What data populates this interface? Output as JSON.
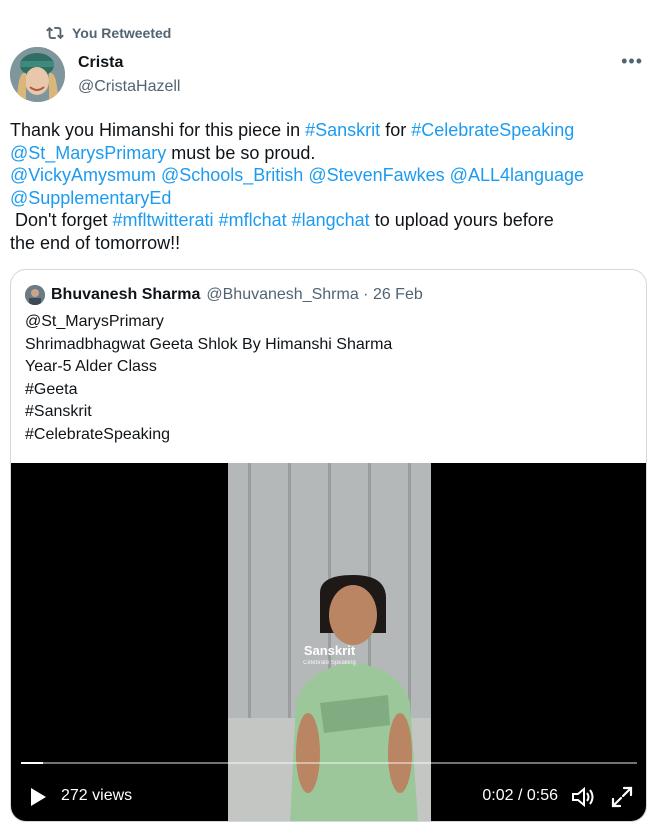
{
  "retweet": {
    "label": "You Retweeted",
    "icon": "retweet-icon"
  },
  "author": {
    "name": "Crista",
    "handle": "@CristaHazell"
  },
  "tweet": {
    "line1_pre": "Thank you Himanshi for this piece in ",
    "tag_sanskrit": "#Sanskrit",
    "line1_mid": " for ",
    "tag_celebrate": "#CelebrateSpeaking",
    "mention_st_marys": "@St_MarysPrimary",
    "line2_post": " must be so proud.",
    "mention_vicky": "@VickyAmysmum",
    "mention_schools": "@Schools_British",
    "mention_steven": "@StevenFawkes",
    "mention_all4": "@ALL4language",
    "mention_supp": "@SupplementaryEd",
    "line5_pre": " Don't forget ",
    "tag_mfltwitterati": "#mfltwitterati",
    "tag_mflchat": "#mflchat",
    "tag_langchat": "#langchat",
    "line5_post": " to upload yours before",
    "line6": "the end of tomorrow!!"
  },
  "quote": {
    "name": "Bhuvanesh Sharma",
    "meta": "@Bhuvanesh_Shrma · 26 Feb",
    "lines": [
      "@St_MarysPrimary",
      "Shrimadbhagwat Geeta Shlok By Himanshi Sharma",
      "Year-5 Alder Class",
      "#Geeta",
      "#Sanskrit",
      "#CelebrateSpeaking"
    ]
  },
  "video": {
    "overlay_title": "Sanskrit",
    "overlay_sub": "Celebrate Speaking",
    "views": "272 views",
    "time": "0:02 / 0:56",
    "progress": 0.036
  },
  "colors": {
    "link": "#1d9bf0",
    "text": "#0f1419",
    "muted": "#536471",
    "border": "#cfd9de"
  }
}
